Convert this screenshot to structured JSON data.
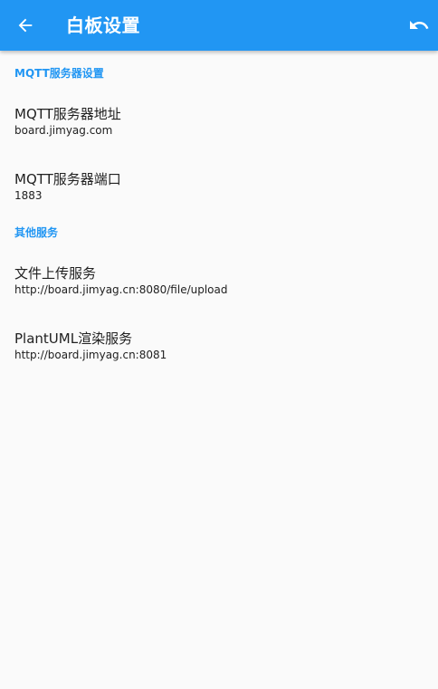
{
  "appbar": {
    "title": "白板设置",
    "back_icon": "arrow-back-icon",
    "undo_icon": "undo-icon",
    "color": "#2196f3"
  },
  "sections": [
    {
      "header": "MQTT服务器设置",
      "items": [
        {
          "title": "MQTT服务器地址",
          "subtitle": "board.jimyag.com"
        },
        {
          "title": "MQTT服务器端口",
          "subtitle": "1883"
        }
      ]
    },
    {
      "header": "其他服务",
      "items": [
        {
          "title": "文件上传服务",
          "subtitle": "http://board.jimyag.cn:8080/file/upload"
        },
        {
          "title": "PlantUML渲染服务",
          "subtitle": "http://board.jimyag.cn:8081"
        }
      ]
    }
  ]
}
